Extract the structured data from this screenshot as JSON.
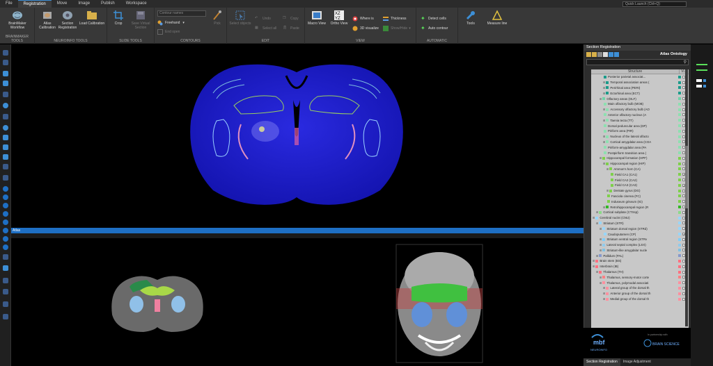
{
  "menu": {
    "tabs": [
      "File",
      "Registration",
      "Move",
      "Image",
      "Publish",
      "Workspace"
    ],
    "active": "Registration",
    "quick_launch_placeholder": "Quick Launch (Ctrl+Q)"
  },
  "ribbon": {
    "brainmaker": {
      "label": "BRAINMAKER TOOLS",
      "workflow": "BrainMaker Workflow"
    },
    "neuroinfo": {
      "label": "NEUROINFO TOOLS",
      "atlas_cal": "Atlas Calibration",
      "section_reg": "Section Registration",
      "load_cal": "Load Calibration"
    },
    "slide": {
      "label": "SLIDE TOOLS",
      "crop": "Crop",
      "save_vs": "Save Virtual Section"
    },
    "contours": {
      "label": "CONTOURS",
      "contour_select": "Contour names",
      "freehand": "Freehand",
      "end_open": "End open",
      "pick": "Pick"
    },
    "edit": {
      "label": "EDIT",
      "select_objects": "Select objects",
      "undo": "Undo",
      "select_all": "Select all",
      "copy": "Copy",
      "paste": "Paste"
    },
    "view": {
      "label": "VIEW",
      "macro": "Macro View",
      "ortho": "Ortho View",
      "where_is": "Where is",
      "visualize": "3D visualize",
      "thickness": "Thickness",
      "show_hide": "Show/Hide"
    },
    "automatic": {
      "label": "AUTOMATIC",
      "detect_cells": "Detect cells",
      "auto_contour": "Auto contour"
    },
    "tools": {
      "tools": "Tools",
      "measure": "Measure line"
    }
  },
  "atlas_panel": {
    "title": "Atlas"
  },
  "right_panel": {
    "title": "Section Registration",
    "ontology_label": "Atlas Ontology",
    "col_structure": "Structure",
    "col_vis": "Vi...",
    "rows": [
      {
        "label": "Posterior parietal associat...",
        "indent": 3,
        "color": "#1a9b8a",
        "checked": false
      },
      {
        "label": "Temporal association areas (",
        "indent": 3,
        "color": "#1a9b8a",
        "checked": false,
        "exp": true
      },
      {
        "label": "Perirhinal area (PERI)",
        "indent": 3,
        "color": "#1a9b8a",
        "checked": false,
        "exp": true
      },
      {
        "label": "Ectorhinal area (ECT)",
        "indent": 3,
        "color": "#1a9b8a",
        "checked": false,
        "exp": true
      },
      {
        "label": "Olfactory areas (OLF)",
        "indent": 2,
        "color": "#6fd3a8",
        "checked": false,
        "exp": true
      },
      {
        "label": "Main olfactory bulb (MOB)",
        "indent": 3,
        "color": "#8de0b0",
        "checked": false
      },
      {
        "label": "Accessory olfactory bulb (AO",
        "indent": 3,
        "color": "#8de0b0",
        "checked": false,
        "exp": true
      },
      {
        "label": "Anterior olfactory nucleus (A",
        "indent": 3,
        "color": "#8de0b0",
        "checked": false
      },
      {
        "label": "Taenia tecta (TT)",
        "indent": 3,
        "color": "#8de0b0",
        "checked": false,
        "exp": true
      },
      {
        "label": "Dorsal peduncular area (DP)",
        "indent": 3,
        "color": "#8de0b0",
        "checked": false
      },
      {
        "label": "Piriform area (PIR)",
        "indent": 3,
        "color": "#8de0b0",
        "checked": false
      },
      {
        "label": "Nucleus of the lateral olfacto",
        "indent": 3,
        "color": "#8de0b0",
        "checked": false,
        "exp": true
      },
      {
        "label": "Cortical amygdalar area (COA",
        "indent": 3,
        "color": "#8de0b0",
        "checked": false,
        "exp": true
      },
      {
        "label": "Piriform-amygdalar area (PA",
        "indent": 3,
        "color": "#8de0b0",
        "checked": false
      },
      {
        "label": "Postpiriform transition area (",
        "indent": 3,
        "color": "#8de0b0",
        "checked": false
      },
      {
        "label": "Hippocampal formation (HPF)",
        "indent": 2,
        "color": "#7ed04b",
        "checked": false,
        "exp": true
      },
      {
        "label": "Hippocampal region (HIP)",
        "indent": 3,
        "color": "#7ed04b",
        "checked": false,
        "exp": true
      },
      {
        "label": "Ammon's horn (CA)",
        "indent": 4,
        "color": "#7ed04b",
        "checked": false,
        "exp": true
      },
      {
        "label": "Field CA1 (CA1)",
        "indent": 5,
        "color": "#7ed04b",
        "checked": true
      },
      {
        "label": "Field CA2 (CA2)",
        "indent": 5,
        "color": "#7ed04b",
        "checked": false
      },
      {
        "label": "Field CA3 (CA3)",
        "indent": 5,
        "color": "#7ed04b",
        "checked": true
      },
      {
        "label": "Dentate gyrus (DG)",
        "indent": 4,
        "color": "#7ed04b",
        "checked": false,
        "exp": true
      },
      {
        "label": "Fasciola cinerea (FC)",
        "indent": 4,
        "color": "#7ed04b",
        "checked": false
      },
      {
        "label": "Induseum griseum (IG)",
        "indent": 4,
        "color": "#7ed04b",
        "checked": false
      },
      {
        "label": "Retrohippocampal region (R",
        "indent": 3,
        "color": "#32b825",
        "checked": false,
        "exp": true
      },
      {
        "label": "Cortical subplate (CTXsp)",
        "indent": 1,
        "color": "#8ada87",
        "checked": false,
        "exp": true
      },
      {
        "label": "Cerebral nuclei (CNU)",
        "indent": 0,
        "color": "#98d6f9",
        "checked": false,
        "exp": true
      },
      {
        "label": "Striatum (STR)",
        "indent": 1,
        "color": "#98d6f9",
        "checked": false,
        "exp": true
      },
      {
        "label": "Striatum dorsal region (STRd)",
        "indent": 2,
        "color": "#98d6f9",
        "checked": false,
        "exp": true
      },
      {
        "label": "Caudoputamen (CP)",
        "indent": 3,
        "color": "#98d6f9",
        "checked": true
      },
      {
        "label": "Striatum ventral region (STRv",
        "indent": 2,
        "color": "#80cdf8",
        "checked": false,
        "exp": true
      },
      {
        "label": "Lateral septal complex (LSX)",
        "indent": 2,
        "color": "#90cbed",
        "checked": false,
        "exp": true
      },
      {
        "label": "Striatum-like amygdalar nucle",
        "indent": 2,
        "color": "#80c0e2",
        "checked": false,
        "exp": true
      },
      {
        "label": "Pallidum (PAL)",
        "indent": 1,
        "color": "#8599cc",
        "checked": false,
        "exp": true
      },
      {
        "label": "Brain stem (BS)",
        "indent": 0,
        "color": "#ff7080",
        "checked": false,
        "exp": true
      },
      {
        "label": "Interbrain (IB)",
        "indent": 0,
        "color": "#ff7080",
        "checked": false,
        "exp": true
      },
      {
        "label": "Thalamus (TH)",
        "indent": 1,
        "color": "#ff7080",
        "checked": false,
        "exp": true
      },
      {
        "label": "Thalamus, sensory-motor corte",
        "indent": 2,
        "color": "#ff8084",
        "checked": false,
        "exp": true
      },
      {
        "label": "Thalamus, polymodal associati",
        "indent": 2,
        "color": "#ff909f",
        "checked": false,
        "exp": true
      },
      {
        "label": "Lateral group of the dorsal th",
        "indent": 3,
        "color": "#ff909f",
        "checked": false,
        "exp": true
      },
      {
        "label": "Anterior group of the dorsal th",
        "indent": 3,
        "color": "#ff909f",
        "checked": false,
        "exp": true
      },
      {
        "label": "Medial group of the dorsal th",
        "indent": 3,
        "color": "#ff909f",
        "checked": false,
        "exp": true
      }
    ],
    "tabs": [
      "Section Registration",
      "Image Adjustment"
    ],
    "active_tab": "Section Registration"
  },
  "logos": {
    "mbf": "mbf",
    "neuroinfo": "NEUROINFO",
    "dev_partner": "In partnership with",
    "brainscience": "BRAIN SCIENCE"
  },
  "colors": {
    "accent": "#1e6fc4",
    "tissue": "#1e1ec8",
    "hippocampus": "#7ed04b",
    "striatum": "#98d6f9",
    "thalamus": "#ff7080"
  }
}
